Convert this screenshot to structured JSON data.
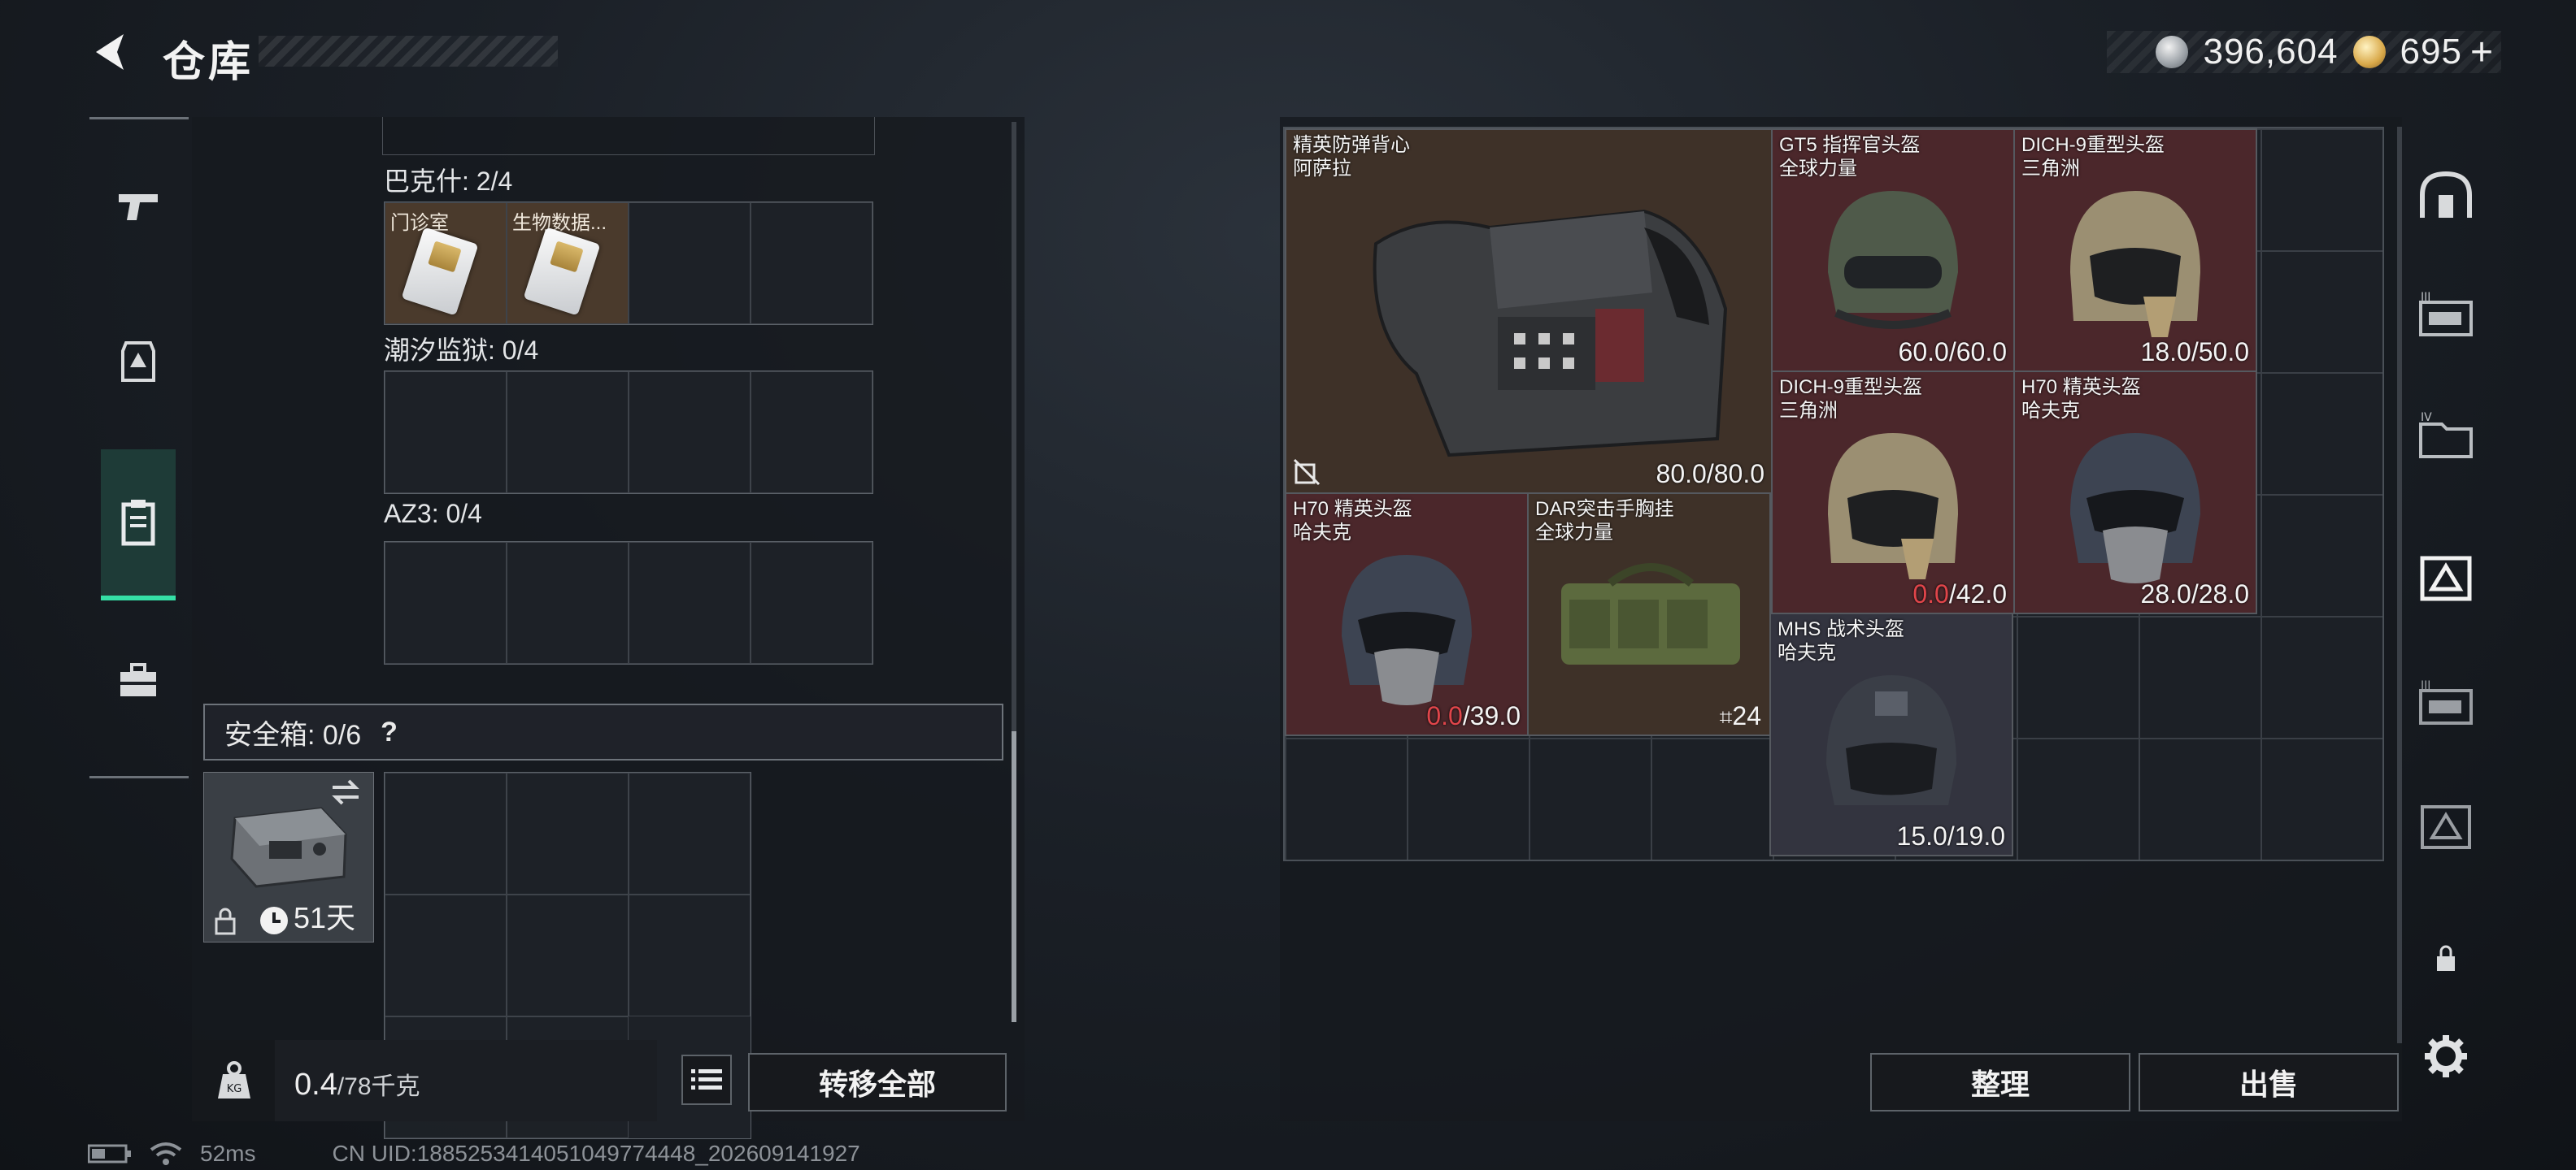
{
  "header": {
    "title": "仓库",
    "currency": [
      {
        "icon": "silver-coin-icon",
        "value": "396,604"
      },
      {
        "icon": "gold-coin-icon",
        "value": "695"
      }
    ],
    "plus": "+"
  },
  "left_nav": [
    {
      "icon": "pistol-icon",
      "active": false
    },
    {
      "icon": "armor-icon",
      "active": false
    },
    {
      "icon": "clipboard-icon",
      "active": true
    },
    {
      "icon": "briefcase-icon",
      "active": false
    }
  ],
  "storage_groups": [
    {
      "label": "巴克什: 2/4",
      "cells": [
        {
          "name": "门诊室",
          "icon": "keycard-icon"
        },
        {
          "name": "生物数据...",
          "icon": "keycard-icon"
        },
        null,
        null
      ]
    },
    {
      "label": "潮汐监狱: 0/4",
      "cells": [
        null,
        null,
        null,
        null
      ]
    },
    {
      "label": "AZ3: 0/4",
      "cells": [
        null,
        null,
        null,
        null
      ]
    }
  ],
  "safe_box": {
    "label": "安全箱:  0/6",
    "help": "?",
    "days": "51天"
  },
  "footer": {
    "weight": "0.4",
    "weight_unit": "/78千克",
    "transfer_all": "转移全部"
  },
  "items": [
    {
      "name": "精英防弹背心\n阿萨拉",
      "durability": "80.0/80.0",
      "color": "brown",
      "kind": "vest"
    },
    {
      "name": "GT5 指挥官头盔\n全球力量",
      "durability": "60.0/60.0",
      "color": "red",
      "kind": "helmet-green"
    },
    {
      "name": "DICH-9重型头盔\n三角洲",
      "durability": "18.0/50.0",
      "color": "red",
      "kind": "helmet-tan"
    },
    {
      "name": "DICH-9重型头盔\n三角洲",
      "dur_bad": "0.0",
      "durability": "/42.0",
      "color": "red",
      "kind": "helmet-tan"
    },
    {
      "name": "H70 精英头盔\n哈夫克",
      "durability": "28.0/28.0",
      "color": "red",
      "kind": "helmet-dark"
    },
    {
      "name": "H70 精英头盔\n哈夫克",
      "dur_bad": "0.0",
      "durability": "/39.0",
      "color": "red",
      "kind": "helmet-dark"
    },
    {
      "name": "DAR突击手胸挂\n全球力量",
      "count": "24",
      "color": "brown",
      "kind": "bag"
    },
    {
      "name": "MHS 战术头盔\n哈夫克",
      "durability": "15.0/19.0",
      "color": "blue",
      "kind": "helmet-navy"
    }
  ],
  "actions": {
    "sort": "整理",
    "sell": "出售"
  },
  "right_nav": [
    {
      "icon": "arch-icon"
    },
    {
      "icon": "storage-ii-icon"
    },
    {
      "icon": "storage-iv-icon"
    },
    {
      "icon": "storage-delta-icon",
      "active": true
    },
    {
      "icon": "storage-iii-icon"
    },
    {
      "icon": "storage-delta2-icon"
    },
    {
      "icon": "lock-icon"
    },
    {
      "icon": "gear-icon"
    }
  ],
  "status": {
    "ping": "52ms",
    "uid": "CN UID:1885253414051049774448_202609141927"
  },
  "colors": {
    "accent": "#35e0a6",
    "item_red": "#4b272b",
    "item_brown": "#3e3128",
    "item_blue": "#33343f",
    "bad_durability": "#e0454a"
  }
}
